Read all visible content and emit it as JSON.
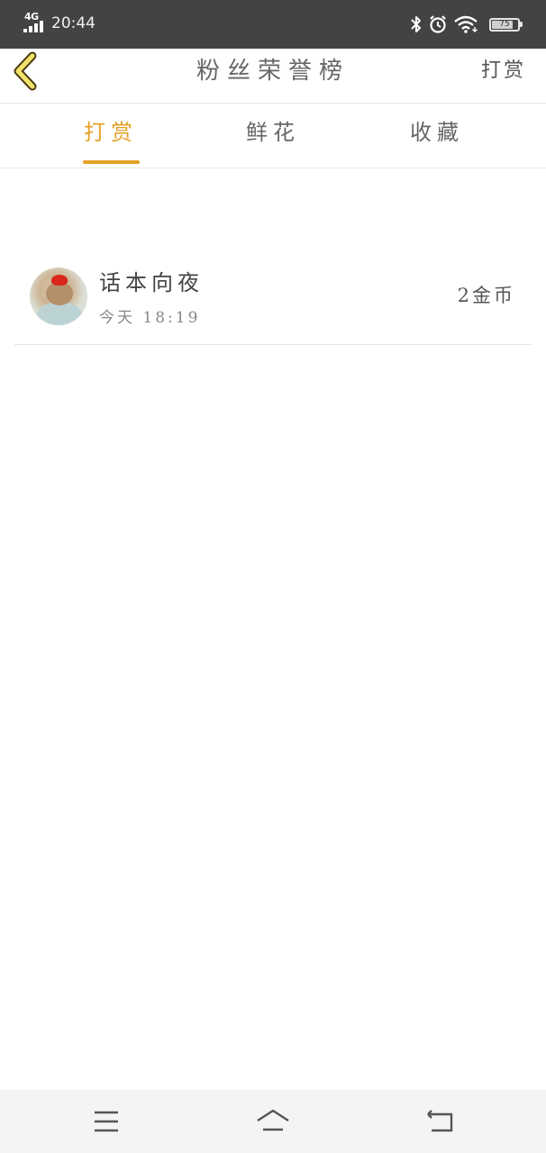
{
  "status_bar": {
    "network": "4G",
    "time": "20:44",
    "battery_level": "75",
    "icons": [
      "bluetooth-icon",
      "alarm-icon",
      "wifi-icon",
      "battery-icon"
    ]
  },
  "header": {
    "title": "粉丝荣誉榜",
    "action_label": "打赏",
    "back_icon": "chevron-left-icon"
  },
  "tabs": [
    {
      "label": "打赏",
      "active": true
    },
    {
      "label": "鲜花",
      "active": false
    },
    {
      "label": "收藏",
      "active": false
    }
  ],
  "list": {
    "items": [
      {
        "name": "话本向夜",
        "time": "今天 18:19",
        "amount": "2金币"
      }
    ]
  },
  "nav_bar": {
    "icons": [
      "menu-icon",
      "home-icon",
      "back-icon"
    ]
  },
  "colors": {
    "accent": "#e3a126",
    "status_bar": "#434343",
    "nav_bar": "#f4f4f4"
  }
}
